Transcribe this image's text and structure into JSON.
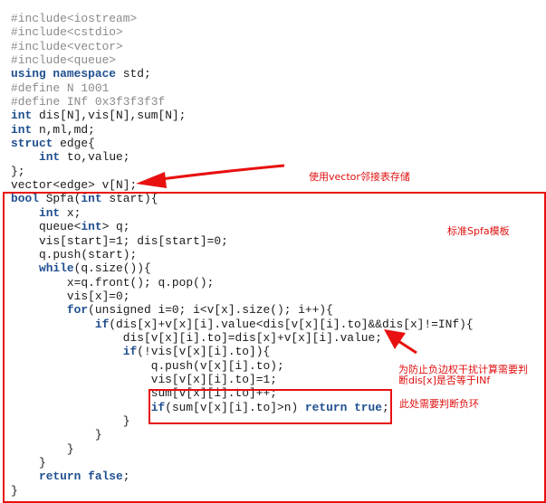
{
  "code_lines": [
    [
      [
        "#include<iostream>",
        "pp"
      ]
    ],
    [
      [
        "#include<cstdio>",
        "pp"
      ]
    ],
    [
      [
        "#include<vector>",
        "pp"
      ]
    ],
    [
      [
        "#include<queue>",
        "pp"
      ]
    ],
    [
      [
        "using namespace",
        "kw"
      ],
      [
        " std;",
        "tx"
      ]
    ],
    [
      [
        "#define N 1001",
        "pp"
      ]
    ],
    [
      [
        "#define INf 0x3f3f3f3f",
        "pp"
      ]
    ],
    [
      [
        "int",
        "kw"
      ],
      [
        " dis[N],vis[N],sum[N];",
        "tx"
      ]
    ],
    [
      [
        "int",
        "kw"
      ],
      [
        " n,ml,md;",
        "tx"
      ]
    ],
    [
      [
        "struct",
        "kw"
      ],
      [
        " edge{",
        "tx"
      ]
    ],
    [
      [
        "    ",
        "tx"
      ],
      [
        "int",
        "kw"
      ],
      [
        " to,value;",
        "tx"
      ]
    ],
    [
      [
        "};",
        "tx"
      ]
    ],
    [
      [
        "vector<edge> v[N];",
        "tx"
      ]
    ],
    [
      [
        "bool",
        "kw"
      ],
      [
        " Spfa(",
        "tx"
      ],
      [
        "int",
        "kw"
      ],
      [
        " start){",
        "tx"
      ]
    ],
    [
      [
        "    ",
        "tx"
      ],
      [
        "int",
        "kw"
      ],
      [
        " x;",
        "tx"
      ]
    ],
    [
      [
        "    queue<",
        "tx"
      ],
      [
        "int",
        "kw"
      ],
      [
        "> q;",
        "tx"
      ]
    ],
    [
      [
        "    vis[start]=1; dis[start]=0;",
        "tx"
      ]
    ],
    [
      [
        "    q.push(start);",
        "tx"
      ]
    ],
    [
      [
        "    ",
        "tx"
      ],
      [
        "while",
        "kw"
      ],
      [
        "(q.size()){",
        "tx"
      ]
    ],
    [
      [
        "        x=q.front(); q.pop();",
        "tx"
      ]
    ],
    [
      [
        "        vis[x]=0;",
        "tx"
      ]
    ],
    [
      [
        "        ",
        "tx"
      ],
      [
        "for",
        "kw"
      ],
      [
        "(unsigned i=0; i<v[x].size(); i++){",
        "tx"
      ]
    ],
    [
      [
        "            ",
        "tx"
      ],
      [
        "if",
        "kw"
      ],
      [
        "(dis[x]+v[x][i].value<dis[v[x][i].to]&&dis[x]!=INf){",
        "tx"
      ]
    ],
    [
      [
        "                dis[v[x][i].to]=dis[x]+v[x][i].value;",
        "tx"
      ]
    ],
    [
      [
        "                ",
        "tx"
      ],
      [
        "if",
        "kw"
      ],
      [
        "(!vis[v[x][i].to]){",
        "tx"
      ]
    ],
    [
      [
        "                    q.push(v[x][i].to);",
        "tx"
      ]
    ],
    [
      [
        "                    vis[v[x][i].to]=1;",
        "tx"
      ]
    ],
    [
      [
        "                    sum[v[x][i].to]++;",
        "tx"
      ]
    ],
    [
      [
        "                    ",
        "tx"
      ],
      [
        "if",
        "kw"
      ],
      [
        "(sum[v[x][i].to]>n) ",
        "tx"
      ],
      [
        "return true",
        "kw"
      ],
      [
        ";",
        "tx"
      ]
    ],
    [
      [
        "                }",
        "tx"
      ]
    ],
    [
      [
        "            }",
        "tx"
      ]
    ],
    [
      [
        "        }",
        "tx"
      ]
    ],
    [
      [
        "    }",
        "tx"
      ]
    ],
    [
      [
        "    ",
        "tx"
      ],
      [
        "return false",
        "kw"
      ],
      [
        ";",
        "tx"
      ]
    ],
    [
      [
        "}",
        "tx"
      ]
    ]
  ],
  "annotations": {
    "vector_note": "使用vector邻接表存储",
    "template_note": "标准Spfa模板",
    "inf_note_line1": "为防止负边权干扰计算需要判",
    "inf_note_line2": "断dis[x]是否等于INf",
    "cycle_note": "此处需要判断负环"
  },
  "colors": {
    "annotation": "#e01010",
    "keyword": "#1f4f8f",
    "preprocessor": "#8a8a8a"
  }
}
